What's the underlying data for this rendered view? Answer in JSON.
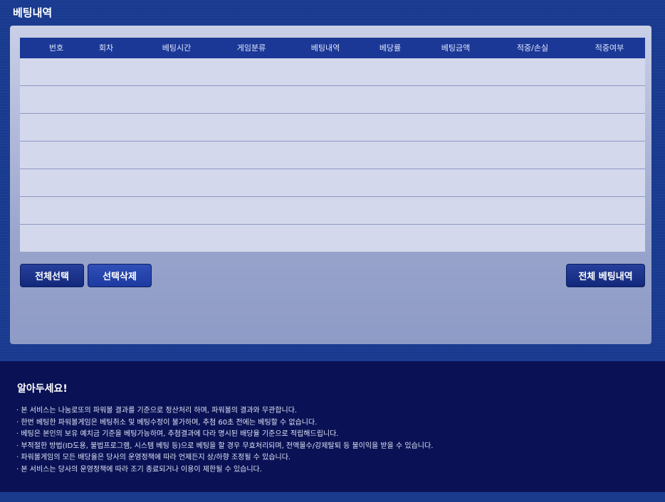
{
  "section_title": "베팅내역",
  "table": {
    "headers": [
      "번호",
      "회차",
      "베팅시간",
      "게임분류",
      "베팅내역",
      "베당률",
      "베팅금액",
      "적중/손실",
      "적중여부"
    ],
    "rows": []
  },
  "buttons": {
    "select_all": "전체선택",
    "delete_selected": "선택삭제",
    "all_history": "전체 베팅내역"
  },
  "notice": {
    "title": "알아두세요!",
    "items": [
      "본 서비스는 나눔로또의 파워볼 결과를 기준으로 정산처리 하며, 파워볼의 결과와 무관합니다.",
      "한번 베팅한 파워볼게임은 베팅취소 및 베팅수정이 불가하며, 추첨 60초 전에는 베팅할 수 없습니다.",
      "베팅은 본인의 보유 예치금 기준을 베팅가능하며, 추첨결과에 다라 명시된 배당율 기준으로 적립해드립니다.",
      "부적절한 방법(ID도용, 불법프로그램, 시스템 베팅 등)으로 베팅을 할 경우 무효처리되며, 전액몰수/강제탈퇴 등 불이익을 받을 수 있습니다.",
      "파워볼게임의 모든 배당율은 당사의 운영정책에 따라 언제든지 상/하향 조정될 수 있습니다.",
      "본 서비스는 당사의 운영정책에 따라 조기 종료되거나 이용이 제한될 수 있습니다."
    ]
  }
}
